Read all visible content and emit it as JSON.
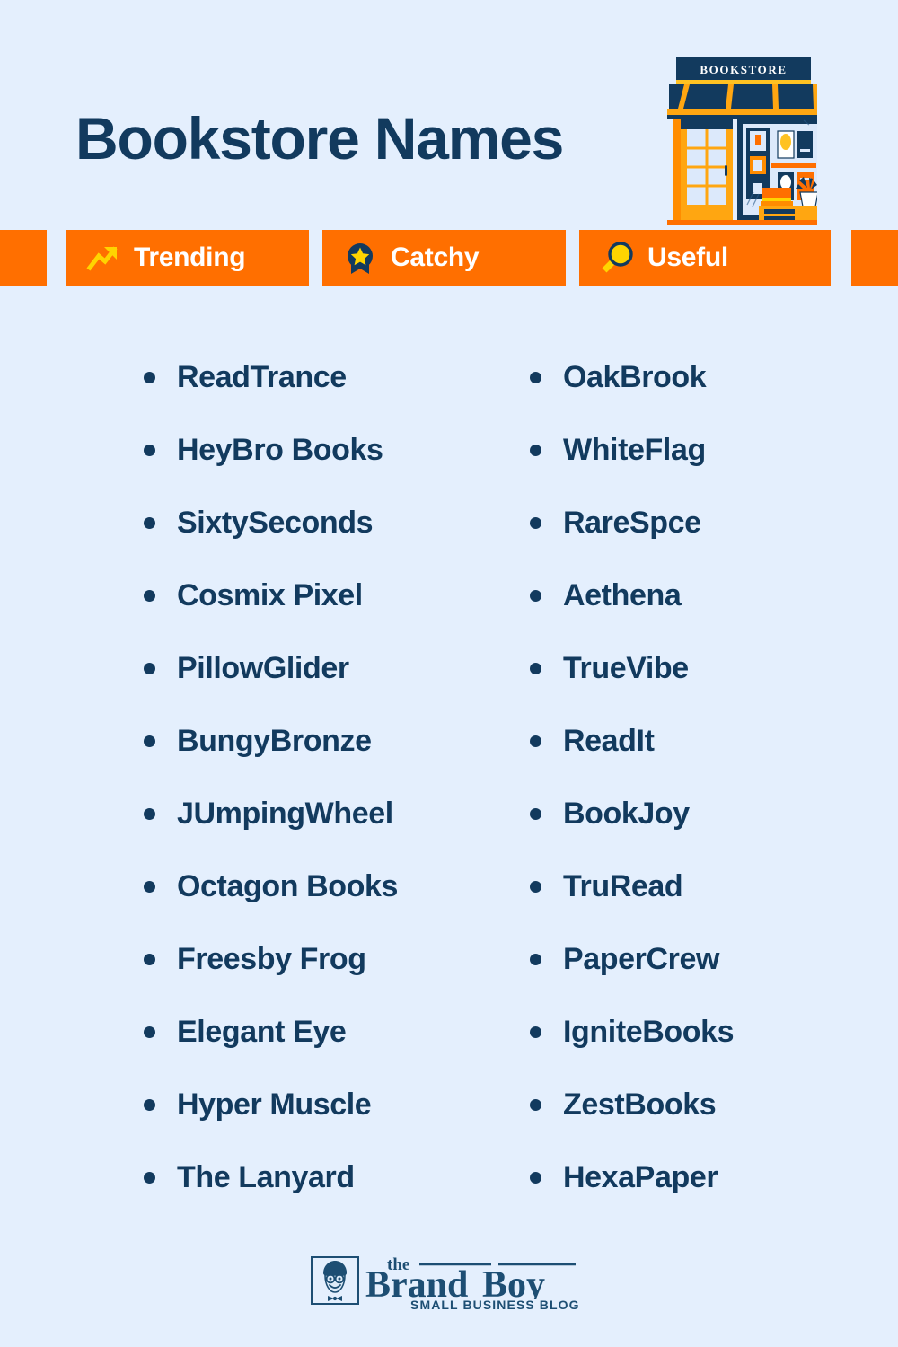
{
  "header": {
    "title": "Bookstore Names",
    "illustration": {
      "name": "bookstore-storefront-illustration",
      "sign_text": "BOOKSTORE"
    }
  },
  "badges": [
    {
      "label": "Trending",
      "icon": "trending-up-arrow-icon"
    },
    {
      "label": "Catchy",
      "icon": "award-medal-star-icon"
    },
    {
      "label": "Useful",
      "icon": "magnifying-glass-icon"
    }
  ],
  "names": {
    "left_column": [
      "ReadTrance",
      "HeyBro Books",
      "SixtySeconds",
      "Cosmix Pixel",
      "PillowGlider",
      "BungyBronze",
      "JUmpingWheel",
      "Octagon Books",
      "Freesby Frog",
      "Elegant Eye",
      "Hyper Muscle",
      "The Lanyard"
    ],
    "right_column": [
      "OakBrook",
      "WhiteFlag",
      "RareSpce",
      "Aethena",
      "TrueVibe",
      "ReadIt",
      "BookJoy",
      "TruRead",
      "PaperCrew",
      "IgniteBooks",
      "ZestBooks",
      "HexaPaper"
    ]
  },
  "footer": {
    "logo": {
      "icon": "brandboy-face-icon",
      "the": "the",
      "brand": "Brand",
      "boy": "Boy",
      "tagline": "SMALL BUSINESS BLOG"
    }
  },
  "colors": {
    "background": "#e4effd",
    "navy": "#123a5e",
    "orange": "#ff6f00",
    "amber": "#ffa611",
    "yellow": "#ffd400",
    "white": "#ffffff"
  }
}
